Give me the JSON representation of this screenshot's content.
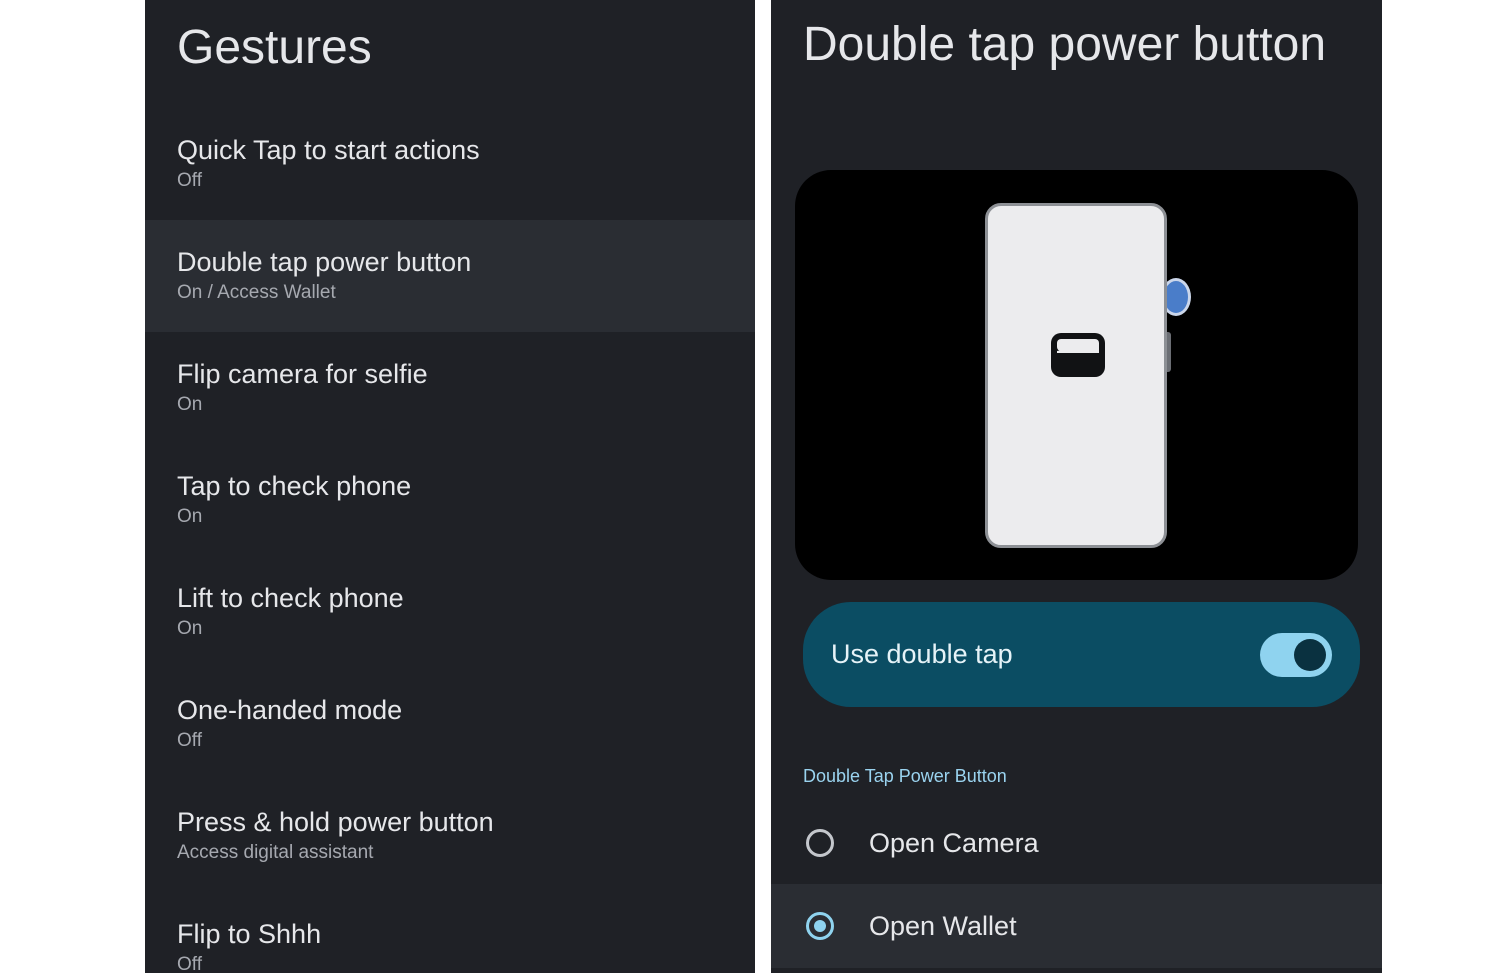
{
  "left_screen": {
    "title": "Gestures",
    "items": [
      {
        "title": "Quick Tap to start actions",
        "subtitle": "Off"
      },
      {
        "title": "Double tap power button",
        "subtitle": "On / Access Wallet"
      },
      {
        "title": "Flip camera for selfie",
        "subtitle": "On"
      },
      {
        "title": "Tap to check phone",
        "subtitle": "On"
      },
      {
        "title": "Lift to check phone",
        "subtitle": "On"
      },
      {
        "title": "One-handed mode",
        "subtitle": "Off"
      },
      {
        "title": "Press & hold power button",
        "subtitle": "Access digital assistant"
      },
      {
        "title": "Flip to Shhh",
        "subtitle": "Off"
      }
    ]
  },
  "right_screen": {
    "title": "Double tap power button",
    "toggle": {
      "label": "Use double tap",
      "on": true
    },
    "section_header": "Double Tap Power Button",
    "options": [
      {
        "label": "Open Camera",
        "selected": false
      },
      {
        "label": "Open Wallet",
        "selected": true
      }
    ]
  },
  "icons": {
    "illustration": "phone-icon",
    "wallet": "wallet-icon"
  },
  "colors": {
    "background": "#1f2126",
    "selected_row": "#2a2d33",
    "toggle_card": "#0b4d63",
    "accent": "#8fd3ef"
  }
}
